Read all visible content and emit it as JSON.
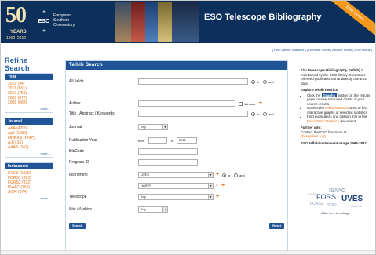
{
  "header": {
    "anniv_number": "50",
    "anniv_years": "YEARS",
    "anniv_dates": "1962–2012",
    "eso_logo": "ESO",
    "org_line1": "European",
    "org_line2": "Southern",
    "org_line3": "Observatory",
    "title": "ESO Telescope Bibliography",
    "ribbon": "ESO Library"
  },
  "toplinks": "[ Help | telbib Statistics ] [ Libraries Home | Archive Home | ESO Home ]",
  "sidebar": {
    "title": "Refine Search",
    "facets": [
      {
        "name": "Year",
        "items": [
          "2012 (94)",
          "2011 (801)",
          "2010 (751)",
          "2009 (677)",
          "2008 (688)"
        ],
        "more": "more..."
      },
      {
        "name": "Journal",
        "items": [
          "A&A (4700)",
          "ApJ (1589)",
          "MNRAS (1247)",
          "AJ (416)",
          "A&AS (242)"
        ],
        "more": "more..."
      },
      {
        "name": "Instrument",
        "items": [
          "UVES (1025)",
          "FORS1 (953)",
          "FORS2 (832)",
          "ISAAC (765)",
          "SOFI (574)"
        ],
        "more": "more..."
      }
    ]
  },
  "form": {
    "title": "Telbib Search",
    "all_fields_label": "All fields",
    "or_label": "or",
    "and_label": "and",
    "author_label": "Author",
    "first_auth_label": "1st auth.",
    "title_label": "Title / Abstract / Keywords",
    "journal_label": "Journal",
    "journal_value": "Any",
    "pubyear_label": "Publication Year",
    "from_label": "from",
    "to_label": "to",
    "to_value": "2012",
    "bibcode_label": "BibCode",
    "programid_label": "Program ID",
    "instrument_label": "Instrument",
    "instrument_value1": "UVES",
    "instrument_value2": "HARPS",
    "telescope_label": "Telescope",
    "telescope_value": "Any",
    "site_label": "Site / Archive",
    "site_value": "Any",
    "search_button": "Search",
    "reset_button": "Reset",
    "plus": "+",
    "minus": "-"
  },
  "info": {
    "p1a": "The ",
    "p1b": "Telescope Bibliography (telbib)",
    "p1c": " is maintained by the ESO library. It contains refereed publications that directly use ESO data.",
    "metrics_title": "Explore telbib metrics:",
    "b1a": "Click the ",
    "b1btn": "Graphs",
    "b1c": " button on the results page to view animated charts of your search results.",
    "b2a": "Access the ",
    "b2link": "telbib Statistics",
    "b2c": " area to find interactive graphs of selected statistics",
    "b3a": "Find publication and citation info in the ",
    "b3link": "Basic ESO Statistics",
    "b3c": " document",
    "further_title": "Further info:",
    "further_text": "Contact the ESO librarians at",
    "email": "library@eso.org",
    "usage_title": "ESO telbib instrument usage 1996-2011",
    "enlarge_pre": "Click ",
    "enlarge_link": "here",
    "enlarge_post": " to enlarge",
    "cloud_words": [
      "ISAAC",
      "FORS1",
      "UVES",
      "FORS2",
      "SOFI",
      "EMMI",
      "HARPS"
    ]
  }
}
